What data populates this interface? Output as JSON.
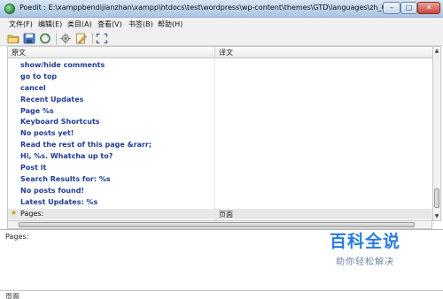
{
  "window": {
    "title": "Poedit : E:\\xamppbendijianzhan\\xampp\\htdocs\\test\\wordpress\\wp-content\\themes\\GTD\\languages\\zh_CN.po",
    "min_label": "–",
    "max_label": "□",
    "close_label": "✕"
  },
  "menu": {
    "items": [
      {
        "label": "文件(F)"
      },
      {
        "label": "编辑(E)"
      },
      {
        "label": "类目(A)"
      },
      {
        "label": "查看(V)"
      },
      {
        "label": "书签(B)"
      },
      {
        "label": "帮助(H)"
      }
    ]
  },
  "toolbar": {
    "buttons": [
      {
        "icon": "open-folder-icon"
      },
      {
        "icon": "save-icon"
      },
      {
        "icon": "update-catalog-icon"
      },
      {
        "icon": "settings-icon"
      },
      {
        "icon": "edit-comment-icon"
      },
      {
        "icon": "fullscreen-icon"
      }
    ]
  },
  "list": {
    "header": {
      "source": "原文",
      "translation": "译文"
    },
    "rows": [
      {
        "source": "show/hide comments",
        "translation": ""
      },
      {
        "source": "go to top",
        "translation": ""
      },
      {
        "source": "cancel",
        "translation": ""
      },
      {
        "source": "Recent Updates",
        "translation": ""
      },
      {
        "source": "Page %s",
        "translation": ""
      },
      {
        "source": "Keyboard Shortcuts",
        "translation": ""
      },
      {
        "source": "No posts yet!",
        "translation": ""
      },
      {
        "source": "Read the rest of this page &rarr;",
        "translation": ""
      },
      {
        "source": "Hi, %s. Whatcha up to?",
        "translation": ""
      },
      {
        "source": "Post it",
        "translation": ""
      },
      {
        "source": "Search Results for: %s",
        "translation": ""
      },
      {
        "source": "No posts found!",
        "translation": ""
      },
      {
        "source": "Latest Updates: %s",
        "translation": ""
      },
      {
        "source": "Pages:",
        "translation": "页面",
        "fuzzy": true
      }
    ]
  },
  "editor": {
    "source_label": "Pages:",
    "translation_label": "页面"
  },
  "watermark": {
    "main": "百科全说",
    "sub": "助你轻松解决"
  }
}
